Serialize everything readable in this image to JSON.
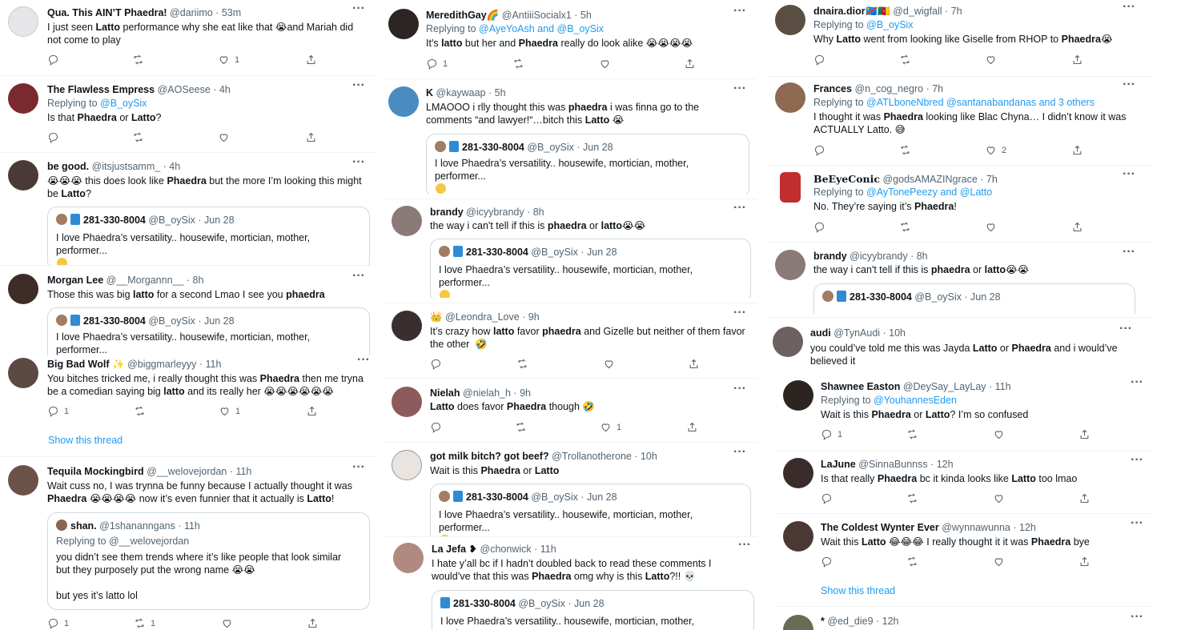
{
  "col1": {
    "t1": {
      "name": "Qua. This AIN’T Phaedra!",
      "handle": "@dariimo · 53m",
      "text_a": "I just seen ",
      "bold_a": "Latto",
      "text_b": " performance why she eat like that 😭and Mariah did not come to play",
      "likes": "1"
    },
    "t2": {
      "name": "The Flawless Empress",
      "handle": "@AOSeese · 4h",
      "replying": "Replying to ",
      "reply_to": "@B_oySix",
      "text_a": "Is that ",
      "bold_a": "Phaedra",
      "text_b": " or ",
      "bold_b": "Latto",
      "text_c": "?"
    },
    "t3": {
      "name": "be good.",
      "handle": "@itsjustsamm_ · 4h",
      "text_a": "😭😭😭 this does look like ",
      "bold_a": "Phaedra",
      "text_b": " but the more I’m looking this might be ",
      "bold_b": "Latto",
      "text_c": "?"
    },
    "t4": {
      "name": "Morgan Lee",
      "handle": "@__Morgannn__ · 8h",
      "text_a": "Those this was big ",
      "bold_a": "latto",
      "text_b": " for a second Lmao I see you ",
      "bold_b": "phaedra"
    },
    "t5": {
      "name": "Big Bad Wolf ✨",
      "handle": "@biggmarleyyy · 11h",
      "text_a": "You bitches tricked me, i really thought this was ",
      "bold_a": "Phaedra",
      "text_b": " then me tryna be a comedian saying big ",
      "bold_b": "latto",
      "text_c": " and its really her 😭😭😭😭😭😭",
      "replies": "1",
      "likes": "1",
      "show_thread": "Show this thread"
    },
    "t6": {
      "name": "Tequila Mockingbird",
      "handle": "@__welovejordan · 11h",
      "text_a": "Wait cuss no, I was trynna be funny because I actually thought it was ",
      "bold_a": "Phaedra",
      "text_b": " 😭😭😭😭 now it’s even funnier that it actually is ",
      "bold_b": "Latto",
      "text_c": "!",
      "q_name": "shan.",
      "q_handle": "@1shananngans · 11h",
      "q_reply": "Replying to @__welovejordan",
      "q_text": "you didn’t see them trends where it’s like people that look similar but they purposely put the wrong name 😭😭",
      "q_text2": "but yes it’s latto lol",
      "replies": "1",
      "retweets": "1"
    }
  },
  "quote_common": {
    "name": "281-330-8004",
    "handle": "@B_oySix · Jun 28",
    "text": "I love Phaedra’s versatility.. housewife, mortician, mother, performer..."
  },
  "col2": {
    "t1": {
      "name": "MeredithGay🌈",
      "handle": "@AntiiiSocialx1 · 5h",
      "replying": "Replying to ",
      "reply_to": "@AyeYoAsh and @B_oySix",
      "text_a": "It's ",
      "bold_a": "latto",
      "text_b": " but her and ",
      "bold_b": "Phaedra",
      "text_c": " really do look alike 😭😭😭😭",
      "replies": "1"
    },
    "t2": {
      "name": "K",
      "handle": "@kaywaap · 5h",
      "text_a": "LMAOOO i rlly thought this was ",
      "bold_a": "phaedra",
      "text_b": " i was finna go to the comments “and lawyer!“…bitch this ",
      "bold_b": "Latto",
      "text_c": " 😭"
    },
    "t3": {
      "name": "brandy",
      "handle": "@icyybrandy · 8h",
      "text_a": "the way i can't tell if this is ",
      "bold_a": "phaedra",
      "text_b": " or ",
      "bold_b": "latto",
      "text_c": "😭😭"
    },
    "t4": {
      "name": "👑",
      "handle": "@Leondra_Love · 9h",
      "text_a": "It’s crazy how ",
      "bold_a": "latto",
      "text_b": " favor ",
      "bold_b": "phaedra",
      "text_c": " and Gizelle but neither of them favor the other  🤣"
    },
    "t5": {
      "name": "Nielah",
      "handle": "@nielah_h · 9h",
      "bold_a": "Latto",
      "text_a": " does favor ",
      "bold_b": "Phaedra",
      "text_b": " though 🤣",
      "likes": "1"
    },
    "t6": {
      "name": "got milk bitch? got beef?",
      "handle": "@Trollanotherone · 10h",
      "text_a": "Wait is this ",
      "bold_a": "Phaedra",
      "text_b": " or ",
      "bold_b": "Latto"
    },
    "t7": {
      "name": "La Jefa ❥",
      "handle": "@chonwick · 11h",
      "text_a": "I hate y’all bc if I hadn’t doubled back to read these comments I would’ve that this was ",
      "bold_a": "Phaedra",
      "text_b": " omg why is this ",
      "bold_b": "Latto",
      "text_c": "?!! 💀"
    }
  },
  "col3": {
    "t1": {
      "name": "dnaira.dior🇨🇩🇨🇲",
      "handle": "@d_wigfall · 7h",
      "replying": "Replying to ",
      "reply_to": "@B_oySix",
      "text_a": "Why ",
      "bold_a": "Latto",
      "text_b": " went from looking like Giselle from RHOP to ",
      "bold_b": "Phaedra",
      "text_c": "😭"
    },
    "t2": {
      "name": "Frances",
      "handle": "@n_cog_negro · 7h",
      "replying": "Replying to ",
      "reply_to": "@ATLboneNbred @santanabandanas and 3 others",
      "text_a": "I thought it was ",
      "bold_a": "Phaedra",
      "text_b": " looking like Blac Chyna… I didn’t know it was ACTUALLY Latto. 😅",
      "likes": "2"
    },
    "t3": {
      "name": "BeEyeConic",
      "handle": "@godsAMAZINgrace · 7h",
      "replying": "Replying to ",
      "reply_to": "@AyTonePeezy and @Latto",
      "text_a": "No. They’re saying it’s ",
      "bold_a": "Phaedra",
      "text_b": "!"
    },
    "t4": {
      "name": "brandy",
      "handle": "@icyybrandy · 8h",
      "text_a": "the way i can't tell if this is ",
      "bold_a": "phaedra",
      "text_b": " or ",
      "bold_b": "latto",
      "text_c": "😭😭"
    },
    "t5": {
      "name": "audi",
      "handle": "@TynAudi · 10h",
      "text_a": "you could’ve told me this was Jayda ",
      "bold_a": "Latto",
      "text_b": " or ",
      "bold_b": "Phaedra",
      "text_c": " and i would’ve believed it"
    },
    "t6": {
      "name": "Shawnee Easton",
      "handle": "@DeySay_LayLay · 11h",
      "replying": "Replying to ",
      "reply_to": "@YouhannesEden",
      "text_a": "Wait is this ",
      "bold_a": "Phaedra",
      "text_b": " or ",
      "bold_b": "Latto",
      "text_c": "? I’m so confused",
      "replies": "1"
    },
    "t7": {
      "name": "LaJune",
      "handle": "@SinnaBunnss · 12h",
      "text_a": "Is that really ",
      "bold_a": "Phaedra",
      "text_b": " bc it kinda looks like ",
      "bold_b": "Latto",
      "text_c": " too lmao"
    },
    "t8": {
      "name": "The Coldest Wynter Ever",
      "handle": "@wynnawunna · 12h",
      "text_a": "Wait this ",
      "bold_a": "Latto",
      "text_b": " 😂😂😂 I really thought it it was ",
      "bold_b": "Phaedra",
      "text_c": " bye",
      "show_thread": "Show this thread"
    },
    "t9": {
      "name": "*",
      "handle": "@ed_die9 · 12h"
    }
  },
  "icons": [
    "reply-icon",
    "retweet-icon",
    "like-icon",
    "share-icon",
    "more-icon"
  ],
  "colors": {
    "link": "#1d9bf0",
    "muted": "#536471",
    "text": "#0f1419",
    "border": "#cfd9de"
  }
}
